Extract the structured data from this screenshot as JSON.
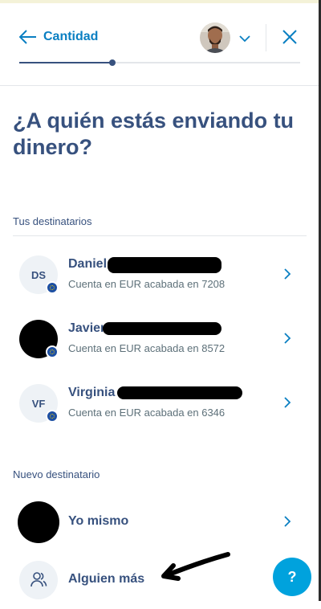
{
  "header": {
    "back_label": "Cantidad",
    "progress": 0.33
  },
  "page_title": "¿A quién estás enviando tu dinero?",
  "recipients": {
    "section_label": "Tus destinatarios",
    "items": [
      {
        "initials": "DS",
        "name": "Daniel",
        "account": "Cuenta en EUR acabada en 7208"
      },
      {
        "initials": "",
        "name": "Javier",
        "account": "Cuenta en EUR acabada en 8572"
      },
      {
        "initials": "VF",
        "name": "Virginia",
        "account": "Cuenta en EUR acabada en 6346"
      }
    ]
  },
  "new_recipient": {
    "section_label": "Nuevo destinatario",
    "myself_label": "Yo mismo",
    "someone_else_label": "Alguien más"
  },
  "help_label": "?",
  "colors": {
    "primary_text": "#37517e",
    "accent": "#0a7fc2",
    "help_button": "#00a2dd",
    "flag_eu": "#1d4fa3"
  },
  "icons": [
    "arrow-left-icon",
    "chevron-down-icon",
    "close-icon",
    "chevron-right-icon",
    "eu-flag-icon",
    "person-icon"
  ]
}
